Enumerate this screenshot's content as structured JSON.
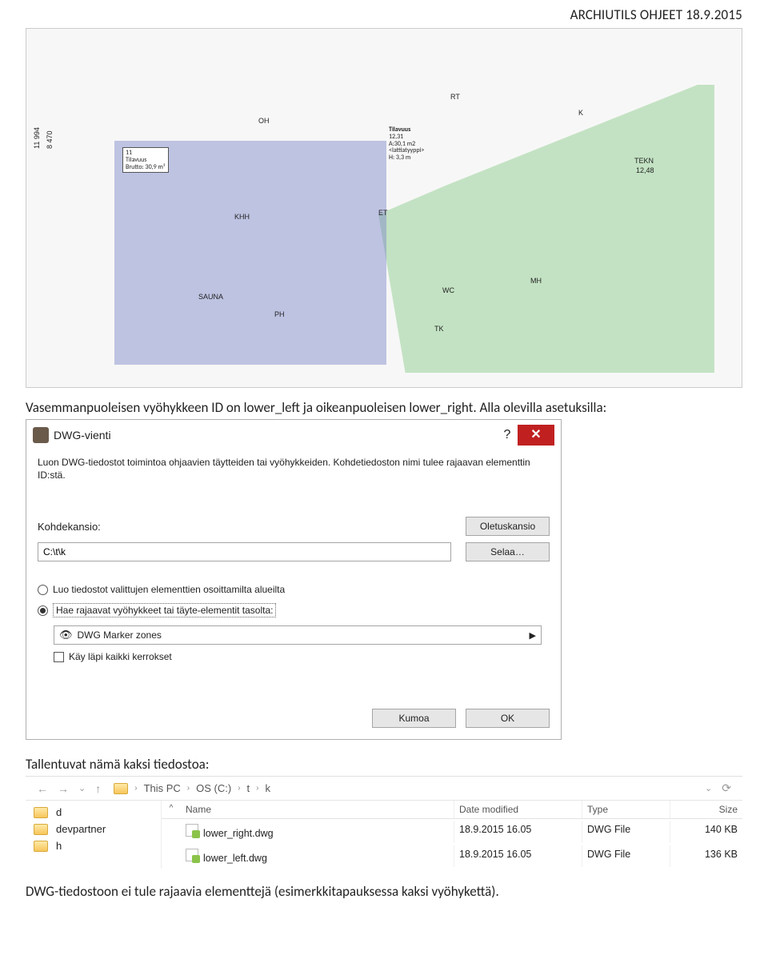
{
  "page_header": "ARCHIUTILS OHJEET 18.9.2015",
  "floorplan": {
    "dim_left1": "11 994",
    "dim_left2": "8 470",
    "zone11_id": "11",
    "zone11_name": "Tilavuus",
    "zone11_brutto": "Brutto: 30,9 m³",
    "center_title": "Tilavuus",
    "center_line1": "12,31",
    "center_area": "A:30,1 m2",
    "center_floor": "<lattiatyyppi>",
    "center_h": "H: 3,3 m",
    "labels": {
      "oh": "OH",
      "rt": "RT",
      "k": "K",
      "khh": "KHH",
      "et": "ET",
      "sauna": "SAUNA",
      "ph": "PH",
      "wc": "WC",
      "tk": "TK",
      "mh": "MH",
      "tekn": "TEKN",
      "tekn_v": "12,48"
    }
  },
  "body_text_1": "Vasemmanpuoleisen vyöhykkeen ID on lower_left ja oikeanpuoleisen lower_right. Alla olevilla asetuksilla:",
  "dialog": {
    "title": "DWG-vienti",
    "description": "Luon DWG-tiedostot toimintoa ohjaavien täytteiden tai vyöhykkeiden. Kohdetiedoston nimi tulee rajaavan elementtin ID:stä.",
    "label_kohdekansio": "Kohdekansio:",
    "btn_oletus": "Oletuskansio",
    "input_path": "C:\\t\\k",
    "btn_selaa": "Selaa…",
    "radio1": "Luo tiedostot valittujen elementtien osoittamilta alueilta",
    "radio2": "Hae rajaavat vyöhykkeet tai täyte-elementit tasolta:",
    "combo_value": "DWG Marker zones",
    "check_label": "Käy läpi kaikki kerrokset",
    "btn_cancel": "Kumoa",
    "btn_ok": "OK"
  },
  "body_text_2": "Tallentuvat nämä kaksi tiedostoa:",
  "explorer": {
    "breadcrumb": [
      "This PC",
      "OS (C:)",
      "t",
      "k"
    ],
    "left_items": [
      "d",
      "devpartner",
      "h"
    ],
    "columns": {
      "name": "Name",
      "date": "Date modified",
      "type": "Type",
      "size": "Size"
    },
    "rows": [
      {
        "name": "lower_right.dwg",
        "date": "18.9.2015 16.05",
        "type": "DWG File",
        "size": "140 KB"
      },
      {
        "name": "lower_left.dwg",
        "date": "18.9.2015 16.05",
        "type": "DWG File",
        "size": "136 KB"
      }
    ]
  },
  "body_text_3": "DWG-tiedostoon ei tule rajaavia elementtejä (esimerkkitapauksessa kaksi vyöhykettä)."
}
